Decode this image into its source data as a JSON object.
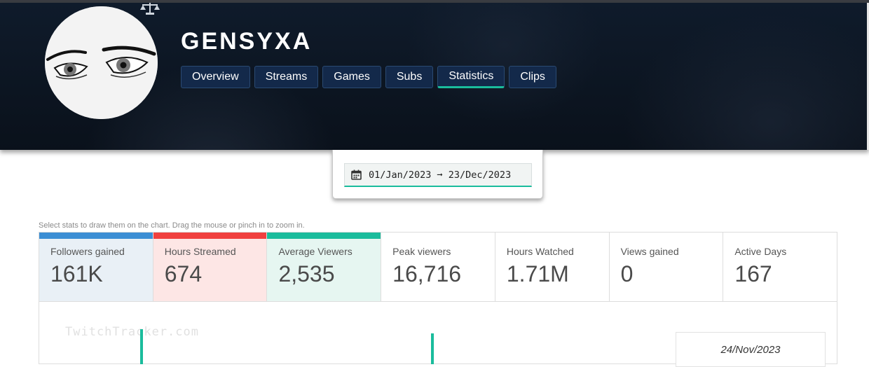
{
  "channel": {
    "name": "GENSYXA"
  },
  "tabs": [
    {
      "label": "Overview",
      "active": false
    },
    {
      "label": "Streams",
      "active": false
    },
    {
      "label": "Games",
      "active": false
    },
    {
      "label": "Subs",
      "active": false
    },
    {
      "label": "Statistics",
      "active": true
    },
    {
      "label": "Clips",
      "active": false
    }
  ],
  "date_range": {
    "value": "01/Jan/2023 ➞ 23/Dec/2023",
    "icon": "calendar-icon"
  },
  "hint": "Select stats to draw them on the chart. Drag the mouse or pinch in to zoom in.",
  "stats": [
    {
      "label": "Followers gained",
      "value": "161K",
      "bar_color": "#3b8ed4",
      "bg_color": "#e9f0f6",
      "selected": true
    },
    {
      "label": "Hours Streamed",
      "value": "674",
      "bar_color": "#f0403f",
      "bg_color": "#fde6e5",
      "selected": true
    },
    {
      "label": "Average Viewers",
      "value": "2,535",
      "bar_color": "#1abc9c",
      "bg_color": "#e6f6f1",
      "selected": true
    },
    {
      "label": "Peak viewers",
      "value": "16,716",
      "bar_color": "",
      "bg_color": "#ffffff",
      "selected": false
    },
    {
      "label": "Hours Watched",
      "value": "1.71M",
      "bar_color": "",
      "bg_color": "#ffffff",
      "selected": false
    },
    {
      "label": "Views gained",
      "value": "0",
      "bar_color": "",
      "bg_color": "#ffffff",
      "selected": false
    },
    {
      "label": "Active Days",
      "value": "167",
      "bar_color": "",
      "bg_color": "#ffffff",
      "selected": false
    }
  ],
  "chart": {
    "watermark": "TwitchTracker.com",
    "tooltip_date": "24/Nov/2023",
    "line_color": "#1abc9c"
  },
  "colors": {
    "accent": "#1abc9c",
    "tab_bg": "#13294a",
    "header_bg": "#0f1b2b"
  }
}
